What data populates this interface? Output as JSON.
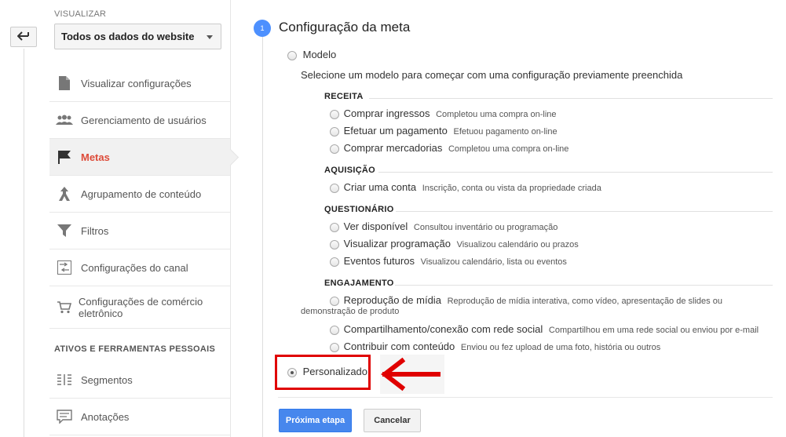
{
  "sidebar": {
    "view_label": "VISUALIZAR",
    "view_select": "Todos os dados do website",
    "items": [
      {
        "label": "Visualizar configurações",
        "icon": "document-icon"
      },
      {
        "label": "Gerenciamento de usuários",
        "icon": "users-icon"
      },
      {
        "label": "Metas",
        "icon": "flag-icon",
        "active": true
      },
      {
        "label": "Agrupamento de conteúdo",
        "icon": "merge-icon"
      },
      {
        "label": "Filtros",
        "icon": "funnel-icon"
      },
      {
        "label": "Configurações do canal",
        "icon": "channel-icon"
      },
      {
        "label": "Configurações de comércio eletrônico",
        "icon": "cart-icon"
      }
    ],
    "section_label": "ATIVOS E FERRAMENTAS PESSOAIS",
    "personal_items": [
      {
        "label": "Segmentos",
        "icon": "segments-icon"
      },
      {
        "label": "Anotações",
        "icon": "comment-icon"
      }
    ]
  },
  "step": {
    "number": "1",
    "title": "Configuração da meta"
  },
  "template": {
    "label": "Modelo",
    "description": "Selecione um modelo para começar com uma configuração previamente preenchida"
  },
  "categories": [
    {
      "title": "RECEITA",
      "options": [
        {
          "label": "Comprar ingressos",
          "desc": "Completou uma compra on-line"
        },
        {
          "label": "Efetuar um pagamento",
          "desc": "Efetuou pagamento on-line"
        },
        {
          "label": "Comprar mercadorias",
          "desc": "Completou uma compra on-line"
        }
      ]
    },
    {
      "title": "AQUISIÇÃO",
      "options": [
        {
          "label": "Criar uma conta",
          "desc": "Inscrição, conta ou vista da propriedade criada"
        }
      ]
    },
    {
      "title": "QUESTIONÁRIO",
      "options": [
        {
          "label": "Ver disponível",
          "desc": "Consultou inventário ou programação"
        },
        {
          "label": "Visualizar programação",
          "desc": "Visualizou calendário ou prazos"
        },
        {
          "label": "Eventos futuros",
          "desc": "Visualizou calendário, lista ou eventos"
        }
      ]
    },
    {
      "title": "ENGAJAMENTO",
      "options": [
        {
          "label": "Reprodução de mídia",
          "desc": "Reprodução de mídia interativa, como vídeo, apresentação de slides ou",
          "desc2": "demonstração de produto"
        },
        {
          "label": "Compartilhamento/conexão com rede social",
          "desc": "Compartilhou em uma rede social ou enviou por e-mail"
        },
        {
          "label": "Contribuir com conteúdo",
          "desc": "Enviou ou fez upload de uma foto, história ou outros"
        }
      ]
    }
  ],
  "custom": {
    "label": "Personalizado",
    "selected": true
  },
  "buttons": {
    "next": "Próxima etapa",
    "cancel": "Cancelar"
  },
  "colors": {
    "accent": "#dd4b39",
    "primary": "#4787ed",
    "highlight": "#e00000"
  }
}
